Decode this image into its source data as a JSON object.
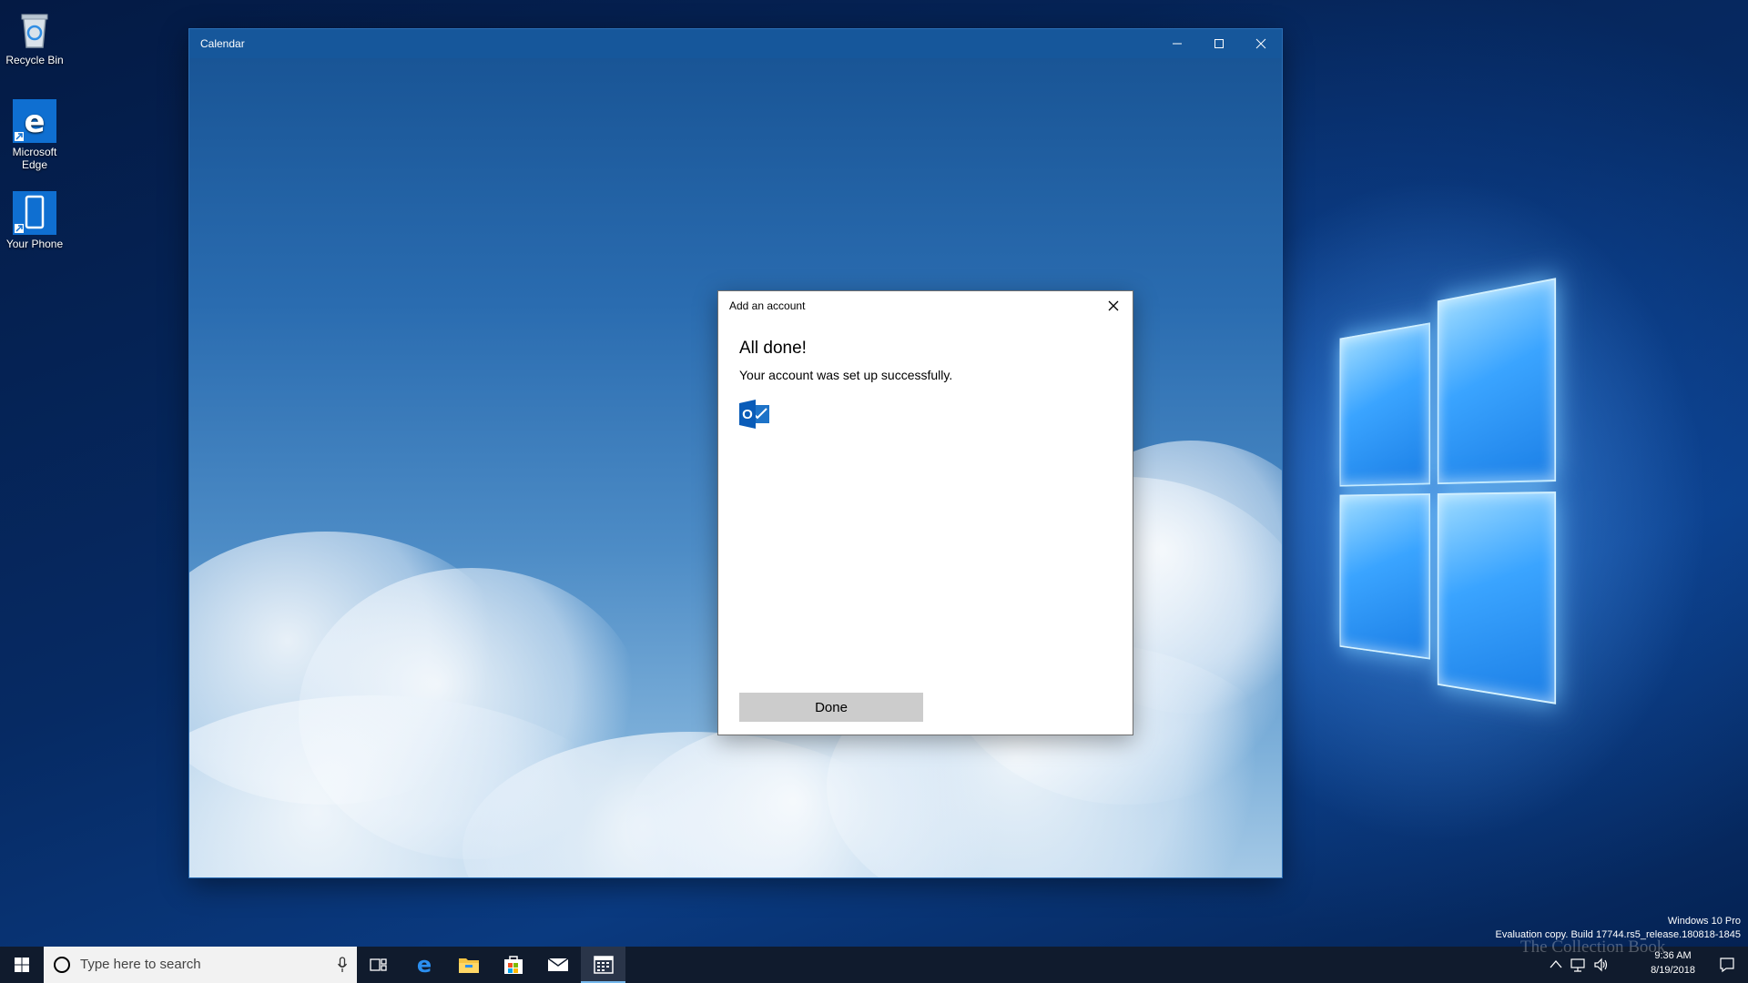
{
  "desktop": {
    "icons": [
      {
        "label": "Recycle Bin",
        "icon": "recycle-bin-icon"
      },
      {
        "label": "Microsoft Edge",
        "icon": "edge-icon"
      },
      {
        "label": "Your Phone",
        "icon": "phone-icon"
      }
    ],
    "watermark_line1": "Windows 10 Pro",
    "watermark_line2": "Evaluation copy. Build 17744.rs5_release.180818-1845",
    "overlay_text": "The Collection Book"
  },
  "window": {
    "title": "Calendar",
    "minimize": "–",
    "maximize": "☐",
    "close": "✕"
  },
  "dialog": {
    "title": "Add an account",
    "heading": "All done!",
    "message": "Your account was set up successfully.",
    "logo_letter": "O",
    "done_label": "Done"
  },
  "taskbar": {
    "search_placeholder": "Type here to search",
    "pinned": [
      "task-view-icon",
      "edge-icon",
      "file-explorer-icon",
      "store-icon",
      "mail-icon",
      "calendar-icon"
    ],
    "time": "9:36 AM",
    "date": "8/19/2018"
  },
  "colors": {
    "accent": "#0078d7",
    "titlebar": "#16579b",
    "taskbar": "#101b2d",
    "button": "#cccccc"
  }
}
